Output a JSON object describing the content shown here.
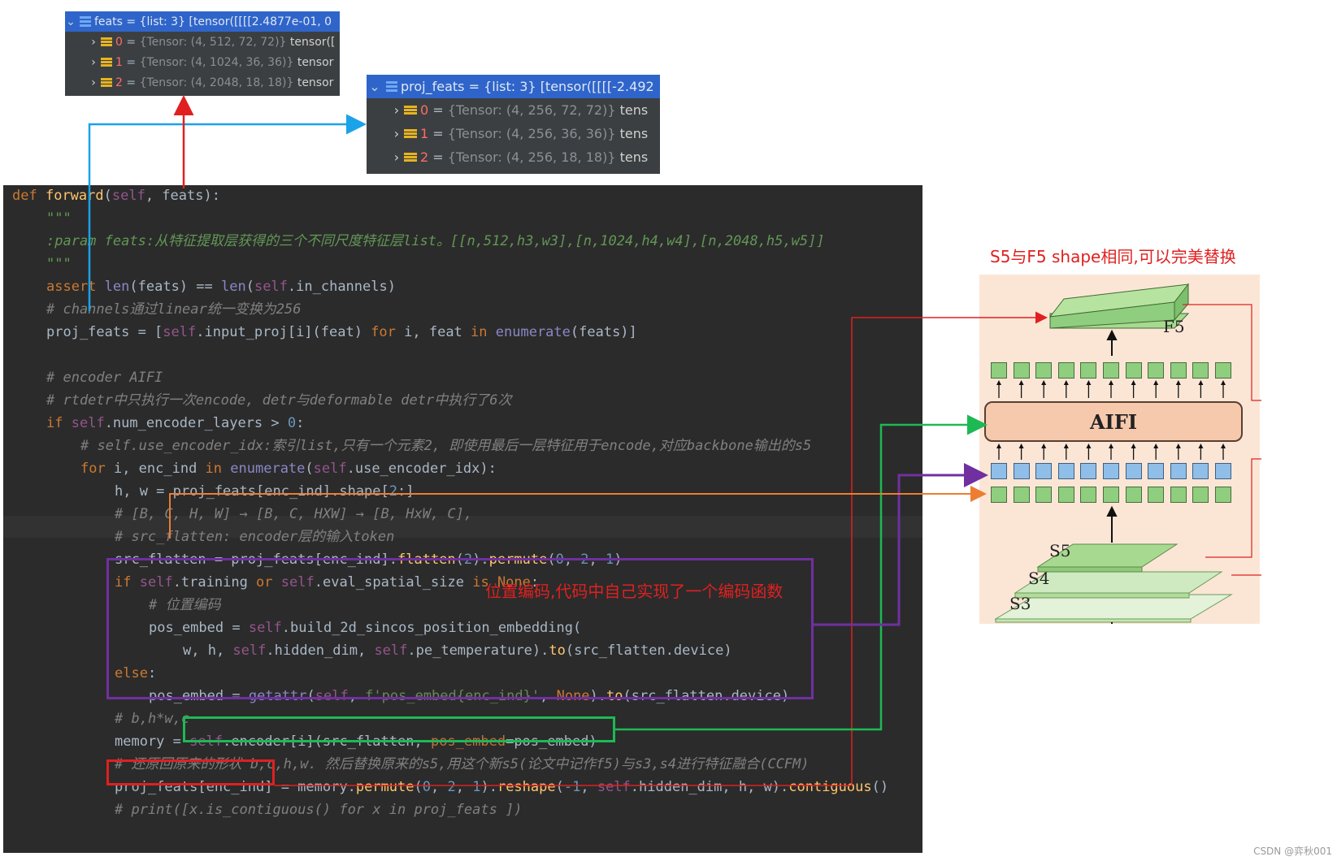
{
  "debug_feats": {
    "header": "feats = {list: 3} [tensor([[[[2.4877e-01, 0",
    "items": [
      {
        "index": "0",
        "value": "{Tensor: (4, 512, 72, 72)}",
        "tail": "tensor(["
      },
      {
        "index": "1",
        "value": "{Tensor: (4, 1024, 36, 36)}",
        "tail": "tensor"
      },
      {
        "index": "2",
        "value": "{Tensor: (4, 2048, 18, 18)}",
        "tail": "tensor"
      }
    ]
  },
  "debug_proj": {
    "header": "proj_feats = {list: 3} [tensor([[[[-2.492",
    "items": [
      {
        "index": "0",
        "value": "{Tensor: (4, 256, 72, 72)}",
        "tail": "tens"
      },
      {
        "index": "1",
        "value": "{Tensor: (4, 256, 36, 36)}",
        "tail": "tens"
      },
      {
        "index": "2",
        "value": "{Tensor: (4, 256, 18, 18)}",
        "tail": "tens"
      }
    ]
  },
  "code": {
    "def_kw": "def",
    "func": "forward",
    "params_open": "(",
    "self": "self",
    "params_rest": ", feats):",
    "doc_quotes": "\"\"\"",
    "doc_param": ":param feats:从特征提取层获得的三个不同尺度特征层list。[[n,512,h3,w3],[n,1024,h4,w4],[n,2048,h5,w5]]",
    "assert_kw": "assert",
    "len1": "len",
    "assert_mid": "(feats) == ",
    "len2": "len",
    "assert_open": "(",
    "assert_tail": ".in_channels)",
    "cm_channels": "# channels通过linear统一变换为256",
    "proj_a": "proj_feats = [",
    "proj_b": ".input_proj[i](feat) ",
    "for_kw": "for",
    "proj_c": " i, feat ",
    "in_kw": "in",
    "enumerate": "enumerate",
    "proj_d": "(feats)]",
    "cm_encoder": "# encoder AIFI",
    "cm_rtdetr": "# rtdetr中只执行一次encode, detr与deformable detr中执行了6次",
    "if_kw": "if",
    "if_a": ".num_encoder_layers > ",
    "zero": "0",
    "colon": ":",
    "cm_use": "# self.use_encoder_idx:索引list,只有一个元素2, 即使用最后一层特征用于encode,对应backbone输出的s5",
    "for_a": " i, enc_ind ",
    "for_b": ".use_encoder_idx):",
    "hw_a": "h, w = proj_feats[enc_ind].shape[",
    "two": "2",
    "hw_b": ":]",
    "cm_shape": "# [B, C, H, W] → [B, C, HXW] → [B, HxW, C],",
    "cm_src": "# src_flatten: encoder层的输入token",
    "src_a": "src_flatten = proj_feats[enc_ind].",
    "flatten": "flatten",
    "src_b": "(",
    "permute": "permute",
    "one": "1",
    "comma": ", ",
    "close": ")",
    "if2_a": ".training ",
    "or_kw": "or",
    "if2_b": ".eval_spatial_size ",
    "is_kw": "is",
    "none_kw": "None",
    "cm_pos": "# 位置编码",
    "pe_a": "pos_embed = ",
    "pe_b": ".build_2d_sincos_position_embedding(",
    "pe_args_a": "w, h, ",
    "pe_args_b": ".hidden_dim, ",
    "pe_args_c": ".pe_temperature).",
    "to": "to",
    "pe_args_d": "(src_flatten.device)",
    "else_kw": "else",
    "ga_a": "pos_embed = ",
    "getattr": "getattr",
    "ga_b": ", ",
    "fstr": "f'pos_embed{enc_ind}'",
    "ga_c": ", ",
    "ga_d": ").",
    "ga_e": "(src_flatten.device)",
    "cm_bhwc": "# b,h*w,c",
    "mem_a": "memory = ",
    "mem_b": ".encoder[i](src_flatten, ",
    "pos_embed_kw": "pos_embed",
    "mem_c": "=pos_embed)",
    "cm_restore": "# 还原回原来的形状 b,c,h,w. 然后替换原来的s5,用这个新s5(论文中记作f5)与s3,s4进行特征融合(CCFM)",
    "pf_a": "proj_feats[enc_ind]",
    "pf_b": " = memory.",
    "reshape": "reshape",
    "neg1": "-1",
    "pf_c": ".hidden_dim, h, w).",
    "contiguous": "contiguous",
    "pf_d": "()",
    "cm_print": "# print([x.is_contiguous() for x in proj_feats ])"
  },
  "annotations": {
    "replace_note": "S5与F5 shape相同,可以完美替换",
    "pos_note": "位置编码,代码中自己实现了一个编码函数"
  },
  "diagram": {
    "aifi": "AIFI",
    "f5": "F5",
    "s5": "S5",
    "s4": "S4",
    "s3": "S3"
  },
  "watermark": "CSDN @弈秋001",
  "colors": {
    "blue": "#1aa3e8",
    "red": "#e02020",
    "green": "#1db954",
    "purple": "#7030a0",
    "orange": "#ed7d31"
  }
}
